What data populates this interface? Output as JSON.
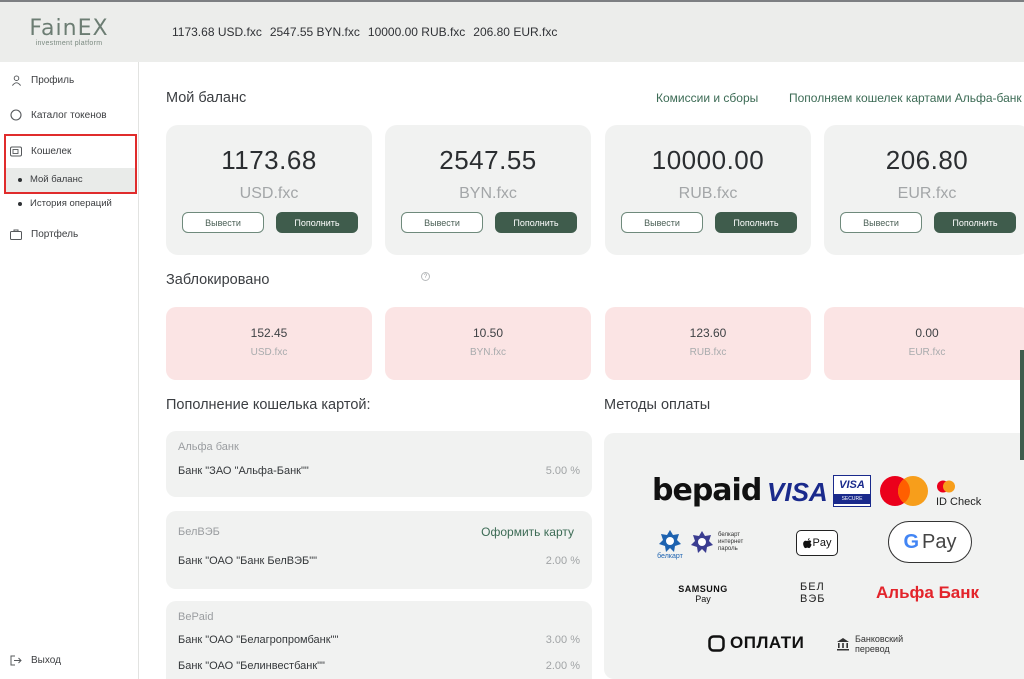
{
  "header": {
    "logo_title": "FainEX",
    "logo_subtitle": "investment platform",
    "balances": [
      "1173.68 USD.fxc",
      "2547.55 BYN.fxc",
      "10000.00 RUB.fxc",
      "206.80 EUR.fxc"
    ]
  },
  "sidebar": {
    "items": [
      {
        "label": "Профиль",
        "icon": "user-icon"
      },
      {
        "label": "Каталог токенов",
        "icon": "circle-icon"
      },
      {
        "label": "Кошелек",
        "icon": "wallet-icon"
      },
      {
        "label": "Портфель",
        "icon": "briefcase-icon"
      }
    ],
    "wallet_sub": [
      "Мой баланс",
      "История операций"
    ],
    "logout": "Выход"
  },
  "main": {
    "balance_title": "Мой баланс",
    "link_fees": "Комиссии и сборы",
    "link_topup_alfa": "Пополняем кошелек картами Альфа-банк",
    "balance_cards": [
      {
        "amount": "1173.68",
        "currency": "USD.fxc"
      },
      {
        "amount": "2547.55",
        "currency": "BYN.fxc"
      },
      {
        "amount": "10000.00",
        "currency": "RUB.fxc"
      },
      {
        "amount": "206.80",
        "currency": "EUR.fxc"
      }
    ],
    "withdraw_label": "Вывести",
    "deposit_label": "Пополнить",
    "blocked_title": "Заблокировано",
    "blocked_cards": [
      {
        "amount": "152.45",
        "currency": "USD.fxc"
      },
      {
        "amount": "10.50",
        "currency": "BYN.fxc"
      },
      {
        "amount": "123.60",
        "currency": "RUB.fxc"
      },
      {
        "amount": "0.00",
        "currency": "EUR.fxc"
      }
    ],
    "card_topup_title": "Пополнение кошелька картой:",
    "payment_methods_title": "Методы оплаты",
    "order_card_label": "Оформить карту",
    "banks": [
      {
        "group": "Альфа банк",
        "rows": [
          {
            "name": "Банк \"ЗАО \"Альфа-Банк\"\"",
            "pct": "5.00 %"
          }
        ]
      },
      {
        "group": "БелВЭБ",
        "rows": [
          {
            "name": "Банк \"ОАО \"Банк БелВЭБ\"\"",
            "pct": "2.00 %"
          }
        ]
      },
      {
        "group": "BePaid",
        "rows": [
          {
            "name": "Банк \"ОАО \"Белагропромбанк\"\"",
            "pct": "3.00 %"
          },
          {
            "name": "Банк \"ОАО \"Белинвестбанк\"\"",
            "pct": "2.00 %"
          }
        ]
      }
    ],
    "payment_logos": {
      "bepaid": "bepaid",
      "visa": "VISA",
      "visa_secure_top": "VISA",
      "visa_secure_bottom": "SECURE",
      "id_check": "ID Check",
      "belkart": "белкарт",
      "belkart_ip_1": "белкарт",
      "belkart_ip_2": "интернет",
      "belkart_ip_3": "пароль",
      "apple_pay": "Pay",
      "google_pay_g": "G",
      "google_pay": "Pay",
      "samsung": "SAMSUNG",
      "samsung_pay": "Pay",
      "belveb_1": "БЕЛ",
      "belveb_2": "ВЭБ",
      "alfa_bank": "Альфа Банк",
      "oplati": "ОПЛАТИ",
      "bank_transfer_1": "Банковский",
      "bank_transfer_2": "перевод"
    }
  }
}
